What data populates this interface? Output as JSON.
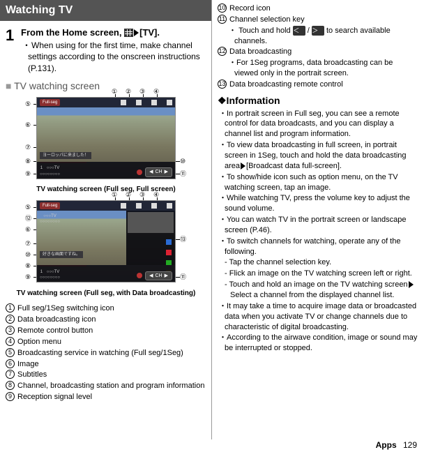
{
  "title": "Watching TV",
  "step": {
    "num": "1",
    "main_a": "From the Home screen, ",
    "main_b": "[TV].",
    "sub": "When using for the first time, make channel settings according to the onscreen instructions (P.131)."
  },
  "section_heading": "TV watching screen",
  "screenshot1": {
    "pill": "Full-seg",
    "subtitle": "ヨーロッパに来ました！",
    "channel_no": "1",
    "station": "○○○TV",
    "program": "○○○○○○○○",
    "ch_label": "CH"
  },
  "caption1": "TV watching screen (Full seg, Full screen)",
  "screenshot2": {
    "pill": "Full-seg",
    "subtitle": "好きな画面ですね。",
    "channel_no": "1",
    "station": "○○○TV",
    "program": "○○○○○○○○",
    "ch_label": "CH"
  },
  "caption2": "TV watching screen (Full seg, with Data broadcasting)",
  "legend": {
    "i1": "Full seg/1Seg switching icon",
    "i2": "Data broadcasting icon",
    "i3": "Remote control button",
    "i4": "Option menu",
    "i5": "Broadcasting service in watching (Full seg/1Seg)",
    "i6": "Image",
    "i7": "Subtitles",
    "i8": "Channel, broadcasting station and program information",
    "i9": "Reception signal level",
    "i10": "Record icon",
    "i11": "Channel selection key",
    "i11_sub_a": "Touch and hold ",
    "i11_sub_b": " / ",
    "i11_sub_c": " to search available channels.",
    "i12": "Data broadcasting",
    "i12_sub": "For 1Seg programs, data broadcasting can be viewed only in the portrait screen.",
    "i13": "Data broadcasting remote control"
  },
  "callouts": {
    "n1": "①",
    "n2": "②",
    "n3": "③",
    "n4": "④",
    "n5": "⑤",
    "n6": "⑥",
    "n7": "⑦",
    "n8": "⑧",
    "n9": "⑨",
    "n10": "⑩",
    "n11": "⑪",
    "n12": "⑫",
    "n13": "⑬"
  },
  "info": {
    "heading": "❖Information",
    "b1": "In portrait screen in Full seg, you can see a remote control for data broadcasts, and you can display a channel list and program information.",
    "b2_a": "To view data broadcasting in full screen, in portrait screen in 1Seg, touch and hold the data broadcasting area",
    "b2_b": "[Broadcast data full-screen].",
    "b3": "To show/hide icon such as option menu, on the TV watching screen, tap an image.",
    "b4": "While watching TV, press the volume key to adjust the sound volume.",
    "b5": "You can watch TV in the portrait screen or landscape screen (P.46).",
    "b6": "To switch channels for watching, operate any of the following.",
    "b6_s1": "Tap the channel selection key.",
    "b6_s2": "Flick an image on the TV watching screen left or right.",
    "b6_s3_a": "Touch and hold an image on the TV watching screen",
    "b6_s3_b": "Select a channel from the displayed channel list.",
    "b7": "It may take a time to acquire image data or broadcasted data when you activate TV or change channels due to characteristic of digital broadcasting.",
    "b8": "According to the airwave condition, image or sound may be interrupted or stopped."
  },
  "footer": {
    "section": "Apps",
    "page": "129"
  },
  "key": {
    "left": "＜",
    "right": "＞"
  }
}
